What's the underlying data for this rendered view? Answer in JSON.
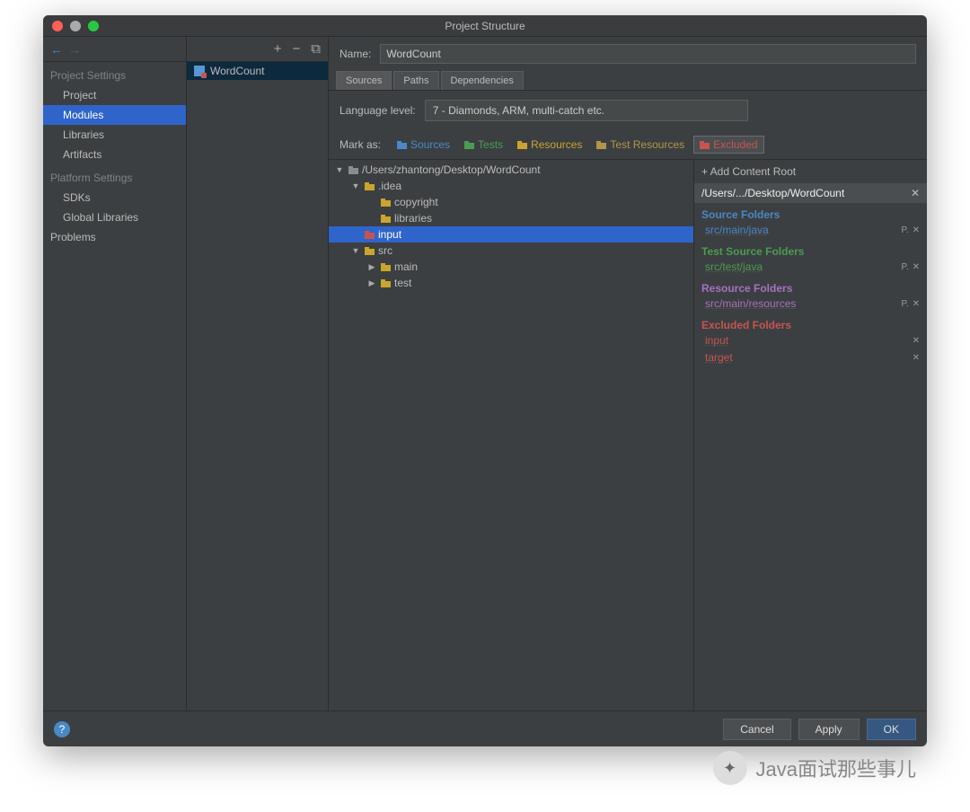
{
  "title": "Project Structure",
  "sidebar": {
    "section1": "Project Settings",
    "items1": [
      "Project",
      "Modules",
      "Libraries",
      "Artifacts"
    ],
    "selected1": 1,
    "section2": "Platform Settings",
    "items2": [
      "SDKs",
      "Global Libraries"
    ],
    "section3": "Problems"
  },
  "modules": {
    "items": [
      "WordCount"
    ]
  },
  "module": {
    "name_label": "Name:",
    "name_value": "WordCount",
    "tabs": [
      "Sources",
      "Paths",
      "Dependencies"
    ],
    "lang_label": "Language level:",
    "lang_value": "7 - Diamonds, ARM, multi-catch etc.",
    "mark_label": "Mark as:",
    "mark_buttons": [
      {
        "label": "Sources",
        "color": "c-blue"
      },
      {
        "label": "Tests",
        "color": "c-green"
      },
      {
        "label": "Resources",
        "color": "c-gold"
      },
      {
        "label": "Test Resources",
        "color": "c-gold2"
      },
      {
        "label": "Excluded",
        "color": "c-red"
      }
    ],
    "mark_selected": 4
  },
  "tree": [
    {
      "indent": 0,
      "tw": "▼",
      "color": "c-gray",
      "label": "/Users/zhantong/Desktop/WordCount"
    },
    {
      "indent": 1,
      "tw": "▼",
      "color": "c-gold",
      "label": ".idea"
    },
    {
      "indent": 2,
      "tw": "",
      "color": "c-gold",
      "label": "copyright"
    },
    {
      "indent": 2,
      "tw": "",
      "color": "c-gold",
      "label": "libraries"
    },
    {
      "indent": 1,
      "tw": "",
      "color": "c-red",
      "label": "input",
      "selected": true
    },
    {
      "indent": 1,
      "tw": "▼",
      "color": "c-gold",
      "label": "src"
    },
    {
      "indent": 2,
      "tw": "▶",
      "color": "c-gold",
      "label": "main"
    },
    {
      "indent": 2,
      "tw": "▶",
      "color": "c-gold",
      "label": "test"
    }
  ],
  "right": {
    "add_root": "+ Add Content Root",
    "root_path": "/Users/.../Desktop/WordCount",
    "groups": [
      {
        "hdr": "Source Folders",
        "color": "#4a88c7",
        "items": [
          {
            "path": "src/main/java",
            "p": true
          }
        ]
      },
      {
        "hdr": "Test Source Folders",
        "color": "#499c54",
        "items": [
          {
            "path": "src/test/java",
            "p": true
          }
        ]
      },
      {
        "hdr": "Resource Folders",
        "color": "#a771bf",
        "items": [
          {
            "path": "src/main/resources",
            "p": true
          }
        ]
      },
      {
        "hdr": "Excluded Folders",
        "color": "#c75450",
        "items": [
          {
            "path": "input"
          },
          {
            "path": "target"
          }
        ]
      }
    ]
  },
  "footer": {
    "cancel": "Cancel",
    "apply": "Apply",
    "ok": "OK"
  },
  "watermark": "Java面试那些事儿"
}
